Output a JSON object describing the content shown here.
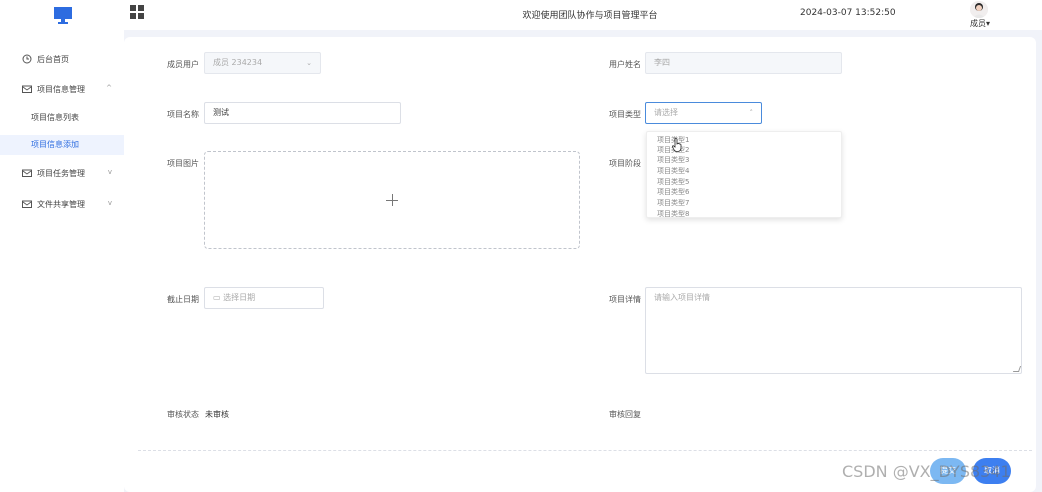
{
  "header": {
    "title": "欢迎使用团队协作与项目管理平台",
    "datetime": "2024-03-07 13:52:50",
    "user_name": "成员",
    "user_arrow": "▾"
  },
  "sidebar": {
    "items": [
      {
        "label": "后台首页",
        "icon": "clock-icon"
      },
      {
        "label": "项目信息管理",
        "icon": "mail-icon",
        "arrow": "^"
      },
      {
        "label": "项目信息列表"
      },
      {
        "label": "项目信息添加",
        "active": true
      },
      {
        "label": "项目任务管理",
        "icon": "mail-icon",
        "arrow": "v"
      },
      {
        "label": "文件共享管理",
        "icon": "mail-icon",
        "arrow": "v"
      }
    ]
  },
  "form": {
    "member_user_label": "成员用户",
    "member_user_value": "成员 234234",
    "user_name_label": "用户姓名",
    "user_name_value": "李四",
    "project_name_label": "项目名称",
    "project_name_value": "测试",
    "project_type_label": "项目类型",
    "project_type_placeholder": "请选择",
    "project_image_label": "项目图片",
    "project_stage_label": "项目阶段",
    "deadline_label": "截止日期",
    "deadline_placeholder": "选择日期",
    "project_detail_label": "项目详情",
    "project_detail_placeholder": "请输入项目详情",
    "audit_status_label": "审核状态",
    "audit_status_value": "未审核",
    "audit_reply_label": "审核回复"
  },
  "dropdown_options": [
    "项目类型1",
    "项目类型2",
    "项目类型3",
    "项目类型4",
    "项目类型5",
    "项目类型6",
    "项目类型7",
    "项目类型8"
  ],
  "buttons": {
    "btn_a": "提交",
    "btn_b": "取消"
  },
  "watermark": "CSDN @VX_DYS8341",
  "colors": {
    "accent": "#2d6ce0",
    "primary_button": "#3d7ff0",
    "light_button": "#7cb8f2"
  }
}
